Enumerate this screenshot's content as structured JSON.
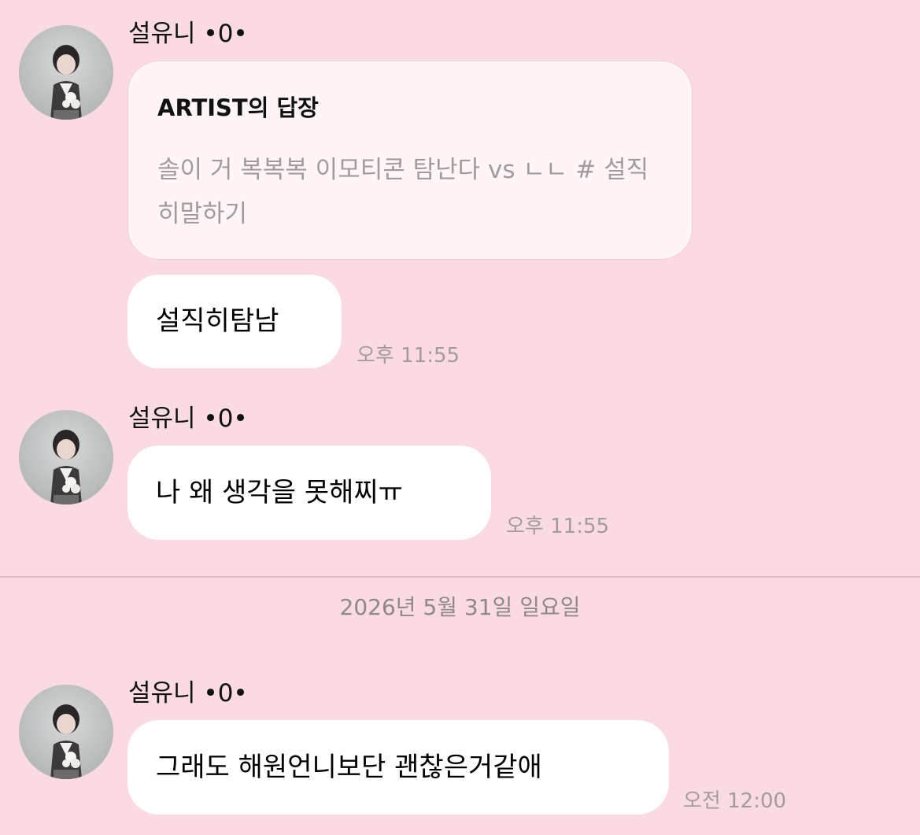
{
  "chat": {
    "messages": [
      {
        "sender": "설유니 •0•",
        "reply": {
          "title": "ARTIST의 답장",
          "text": "솔이 거 복복복 이모티콘 탐난다 vs ㄴㄴ # 설직히말하기"
        },
        "text": "설직히탐남",
        "time": "오후 11:55"
      },
      {
        "sender": "설유니 •0•",
        "text": "나 왜 생각을 못해찌ㅠ",
        "time": "오후 11:55"
      },
      {
        "sender": "설유니 •0•",
        "text": "그래도 해원언니보단 괜찮은거같애",
        "time": "오전 12:00"
      }
    ],
    "date_separator": "2026년 5월 31일 일요일"
  },
  "icons": {
    "avatar": "profile-photo-avatar"
  },
  "colors": {
    "background": "#fadbe1",
    "bubble": "#ffffff",
    "reply_card": "#fff5f6",
    "timestamp": "#a39b9d"
  }
}
